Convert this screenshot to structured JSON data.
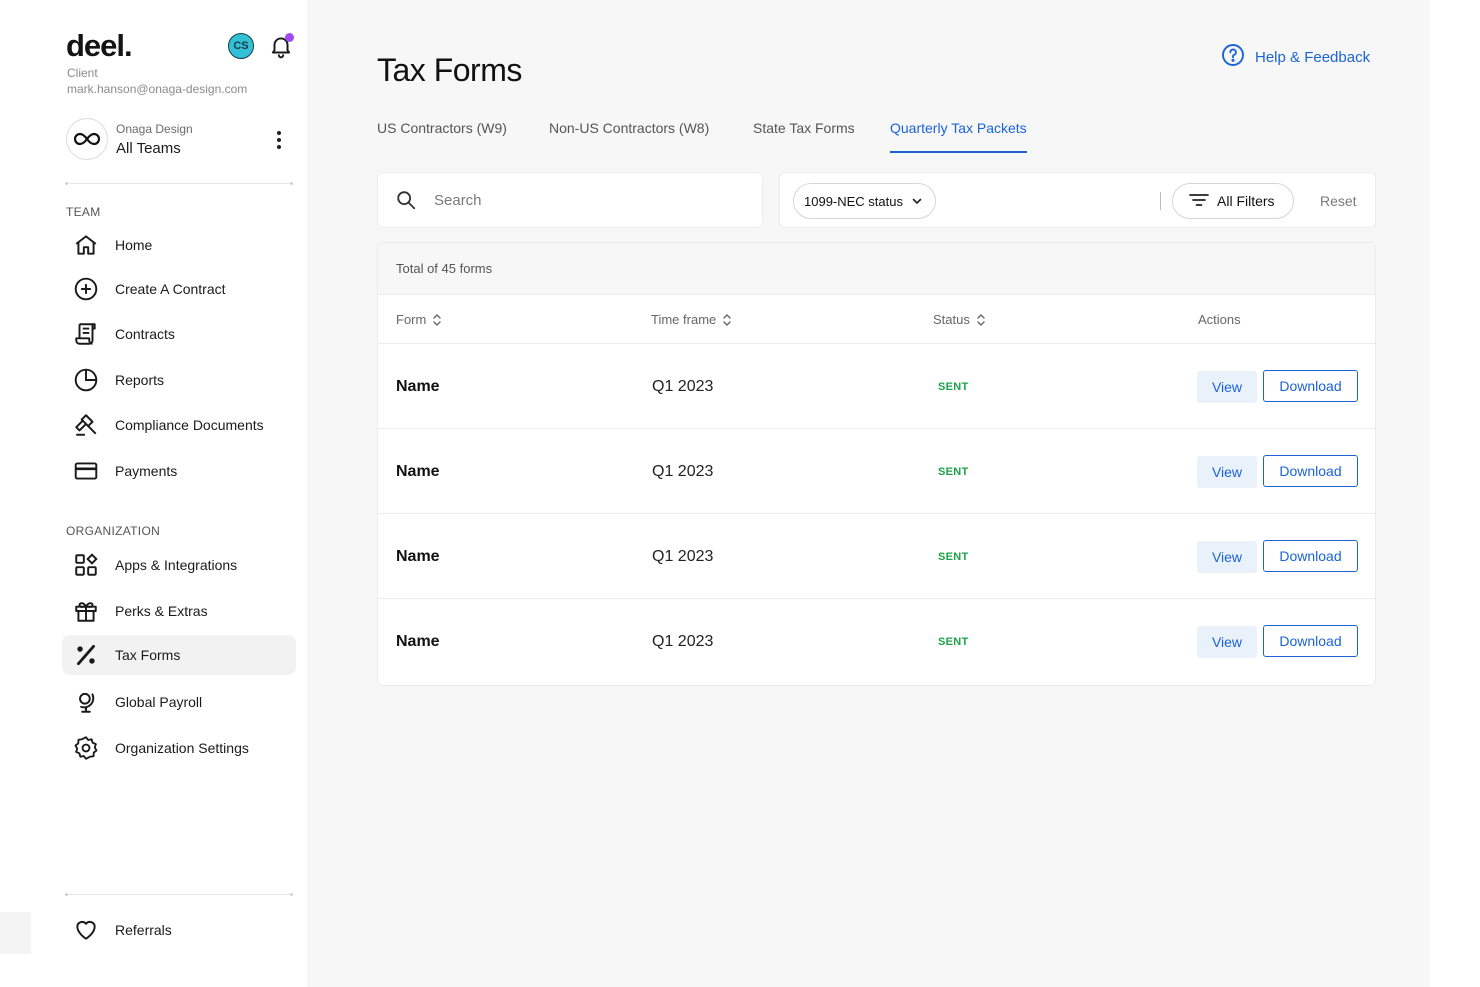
{
  "sidebar": {
    "logo": "deel",
    "logo_dot": ".",
    "avatar_initials": "CS",
    "role": "Client",
    "email": "mark.hanson@onaga-design.com",
    "org": {
      "company": "Onaga Design",
      "team": "All Teams"
    },
    "team_label": "TEAM",
    "team_items": [
      {
        "label": "Home",
        "icon": "home-icon"
      },
      {
        "label": "Create A Contract",
        "icon": "plus-circle-icon"
      },
      {
        "label": "Contracts",
        "icon": "scroll-icon"
      },
      {
        "label": "Reports",
        "icon": "pie-chart-icon"
      },
      {
        "label": "Compliance Documents",
        "icon": "gavel-icon"
      },
      {
        "label": "Payments",
        "icon": "credit-card-icon"
      }
    ],
    "org_label": "ORGANIZATION",
    "org_items": [
      {
        "label": "Apps & Integrations",
        "icon": "apps-grid-icon"
      },
      {
        "label": "Perks & Extras",
        "icon": "gift-icon"
      },
      {
        "label": "Tax Forms",
        "icon": "percent-icon",
        "active": true
      },
      {
        "label": "Global Payroll",
        "icon": "globe-stand-icon"
      },
      {
        "label": "Organization Settings",
        "icon": "gear-icon"
      }
    ],
    "referrals": {
      "label": "Referrals",
      "icon": "heart-icon"
    }
  },
  "header": {
    "title": "Tax Forms",
    "help_label": "Help & Feedback"
  },
  "tabs": [
    {
      "label": "US Contractors (W9)"
    },
    {
      "label": "Non-US Contractors (W8)"
    },
    {
      "label": "State Tax Forms"
    },
    {
      "label": "Quarterly Tax Packets",
      "active": true
    }
  ],
  "search": {
    "placeholder": "Search",
    "value": ""
  },
  "filters": {
    "status_label": "1099-NEC status",
    "all_filters_label": "All Filters",
    "reset_label": "Reset"
  },
  "table": {
    "total_text": "Total of 45 forms",
    "columns": [
      "Form",
      "Time frame",
      "Status",
      "Actions"
    ],
    "rows": [
      {
        "form": "Name",
        "time_frame": "Q1 2023",
        "status": "SENT",
        "view": "View",
        "download": "Download"
      },
      {
        "form": "Name",
        "time_frame": "Q1 2023",
        "status": "SENT",
        "view": "View",
        "download": "Download"
      },
      {
        "form": "Name",
        "time_frame": "Q1 2023",
        "status": "SENT",
        "view": "View",
        "download": "Download"
      },
      {
        "form": "Name",
        "time_frame": "Q1 2023",
        "status": "SENT",
        "view": "View",
        "download": "Download"
      }
    ]
  },
  "colors": {
    "accent": "#1b63d6",
    "status_sent": "#1ea34a",
    "avatar_bg": "#31c0d6",
    "notification_dot": "#a04cf0"
  }
}
